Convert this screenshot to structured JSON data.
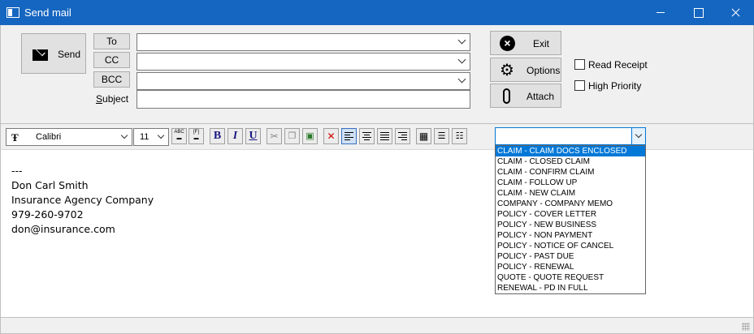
{
  "window": {
    "title": "Send mail"
  },
  "header": {
    "send_label": "Send",
    "to_label": "To",
    "cc_label": "CC",
    "bcc_label": "BCC",
    "subject_label": "Subject",
    "to_value": "",
    "cc_value": "",
    "bcc_value": "",
    "subject_value": "",
    "exit_label": "Exit",
    "options_label": "Options",
    "attach_label": "Attach",
    "read_receipt_label": "Read Receipt",
    "high_priority_label": "High Priority",
    "read_receipt_checked": false,
    "high_priority_checked": false
  },
  "toolbar": {
    "font_family": "Calibri",
    "font_size": "11",
    "bold": "B",
    "italic": "I",
    "underline": "U"
  },
  "body": {
    "lines": [
      "---",
      "Don Carl Smith",
      "Insurance Agency Company",
      "979-260-9702",
      "don@insurance.com"
    ]
  },
  "templates": {
    "selected_value": "",
    "items": [
      "CLAIM - CLAIM DOCS ENCLOSED",
      "CLAIM - CLOSED CLAIM",
      "CLAIM - CONFIRM CLAIM",
      "CLAIM - FOLLOW UP",
      "CLAIM - NEW CLAIM",
      "COMPANY - COMPANY MEMO",
      "POLICY - COVER LETTER",
      "POLICY - NEW BUSINESS",
      "POLICY - NON PAYMENT",
      "POLICY - NOTICE OF CANCEL",
      "POLICY - PAST DUE",
      "POLICY - RENEWAL",
      "QUOTE - QUOTE REQUEST",
      "RENEWAL - PD IN FULL"
    ],
    "highlighted_index": 0
  },
  "colors": {
    "titlebar": "#1566c0",
    "selection": "#0078d7"
  }
}
